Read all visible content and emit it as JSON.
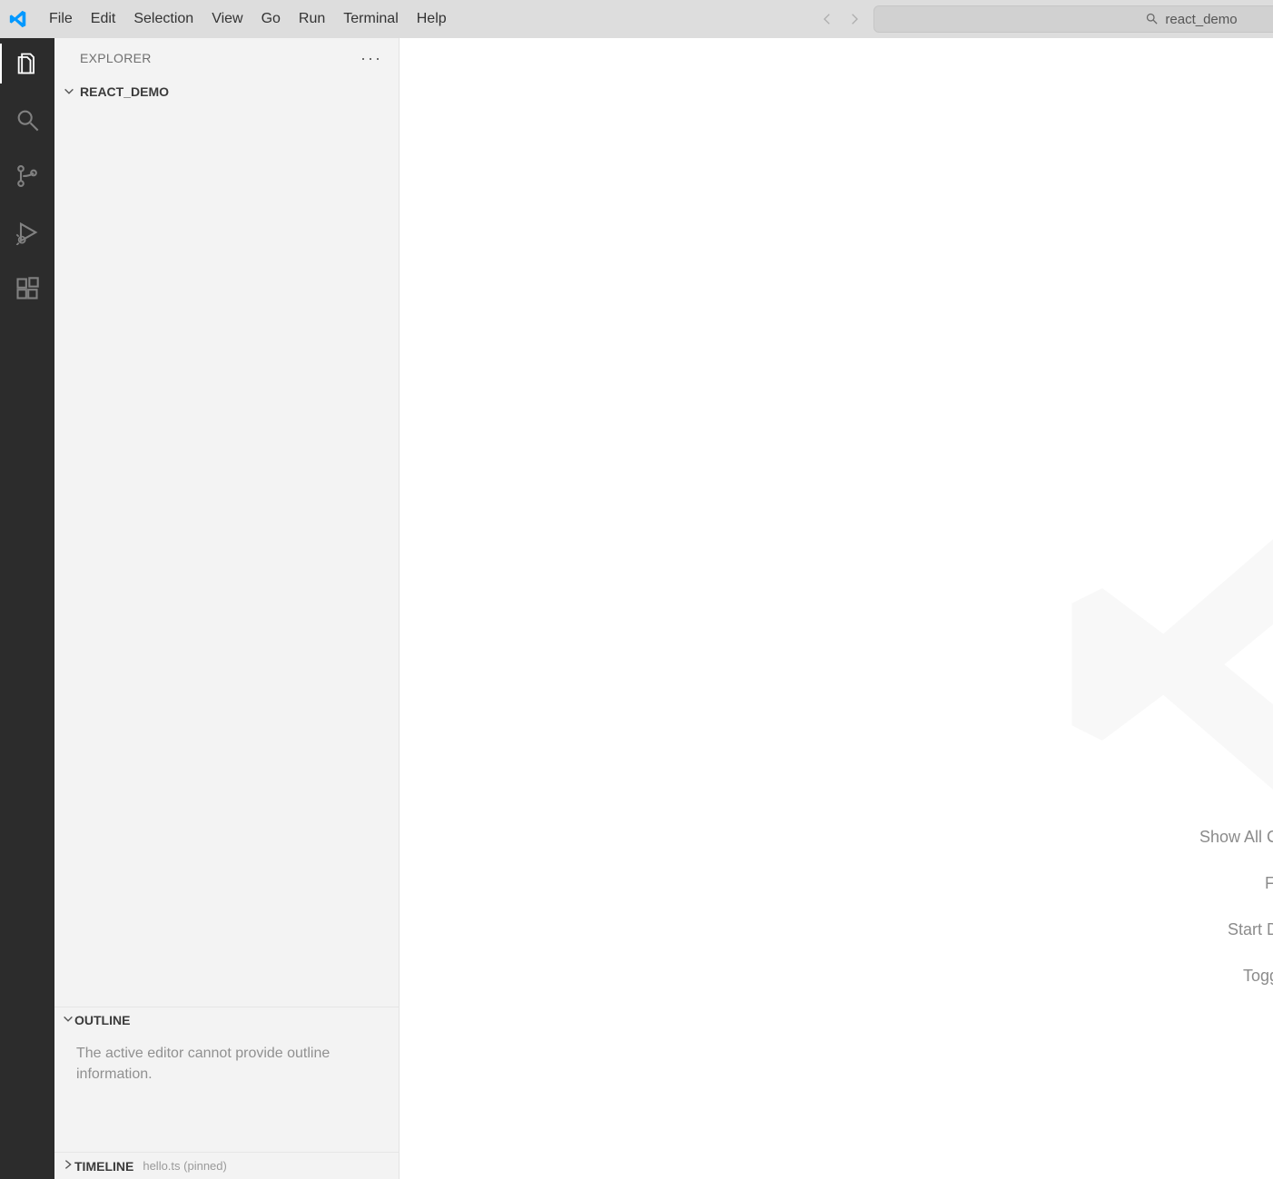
{
  "menubar": {
    "items": [
      "File",
      "Edit",
      "Selection",
      "View",
      "Go",
      "Run",
      "Terminal",
      "Help"
    ],
    "searchLabel": "react_demo"
  },
  "sidebar": {
    "title": "EXPLORER",
    "folder": {
      "name": "REACT_DEMO"
    },
    "outline": {
      "title": "OUTLINE",
      "message": "The active editor cannot provide outline information."
    },
    "timeline": {
      "title": "TIMELINE",
      "meta": "hello.ts (pinned)"
    }
  },
  "editor": {
    "shortcuts": [
      "Show All C",
      "Fi",
      "Start D",
      "Togg"
    ]
  }
}
